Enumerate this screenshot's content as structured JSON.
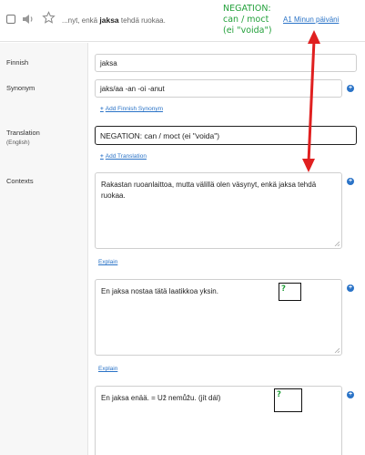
{
  "header": {
    "snippet_prefix": "...nyt, enkä",
    "snippet_word": "jaksa",
    "snippet_suffix": "tehdä ruokaa.",
    "annotation_lines": [
      "NEGATION:",
      "can / moct",
      "(ei \"voida\")"
    ],
    "level_link": "A1 Minun päiväni",
    "icons": [
      "checkbox-icon",
      "speaker-icon",
      "star-icon"
    ]
  },
  "form": {
    "finnish": {
      "label": "Finnish",
      "value": "jaksa"
    },
    "synonym": {
      "label": "Synonym",
      "value": "jaks/aa -an -oi -anut",
      "add_link": "Add Finnish Synonym"
    },
    "translation": {
      "label": "Translation",
      "sublabel": "(English)",
      "value": "NEGATION: can / moct (ei \"voida\")",
      "add_link": "Add Translation"
    },
    "contexts": {
      "label": "Contexts",
      "explain_label": "Explain",
      "items": [
        {
          "text": "Rakastan ruoanlaittoa, mutta välillä olen väsynyt, enkä jaksa tehdä ruokaa."
        },
        {
          "text": "En jaksa nostaa tätä laatikkoa yksin.",
          "marker": "?"
        },
        {
          "text": "En jaksa enää. = Už nemůžu. (jít dál)",
          "marker": "?"
        }
      ]
    }
  },
  "colors": {
    "link": "#2a73c7",
    "annotation": "#22a03a",
    "arrow": "#e02020",
    "sidebar": "#f7f7f7"
  }
}
